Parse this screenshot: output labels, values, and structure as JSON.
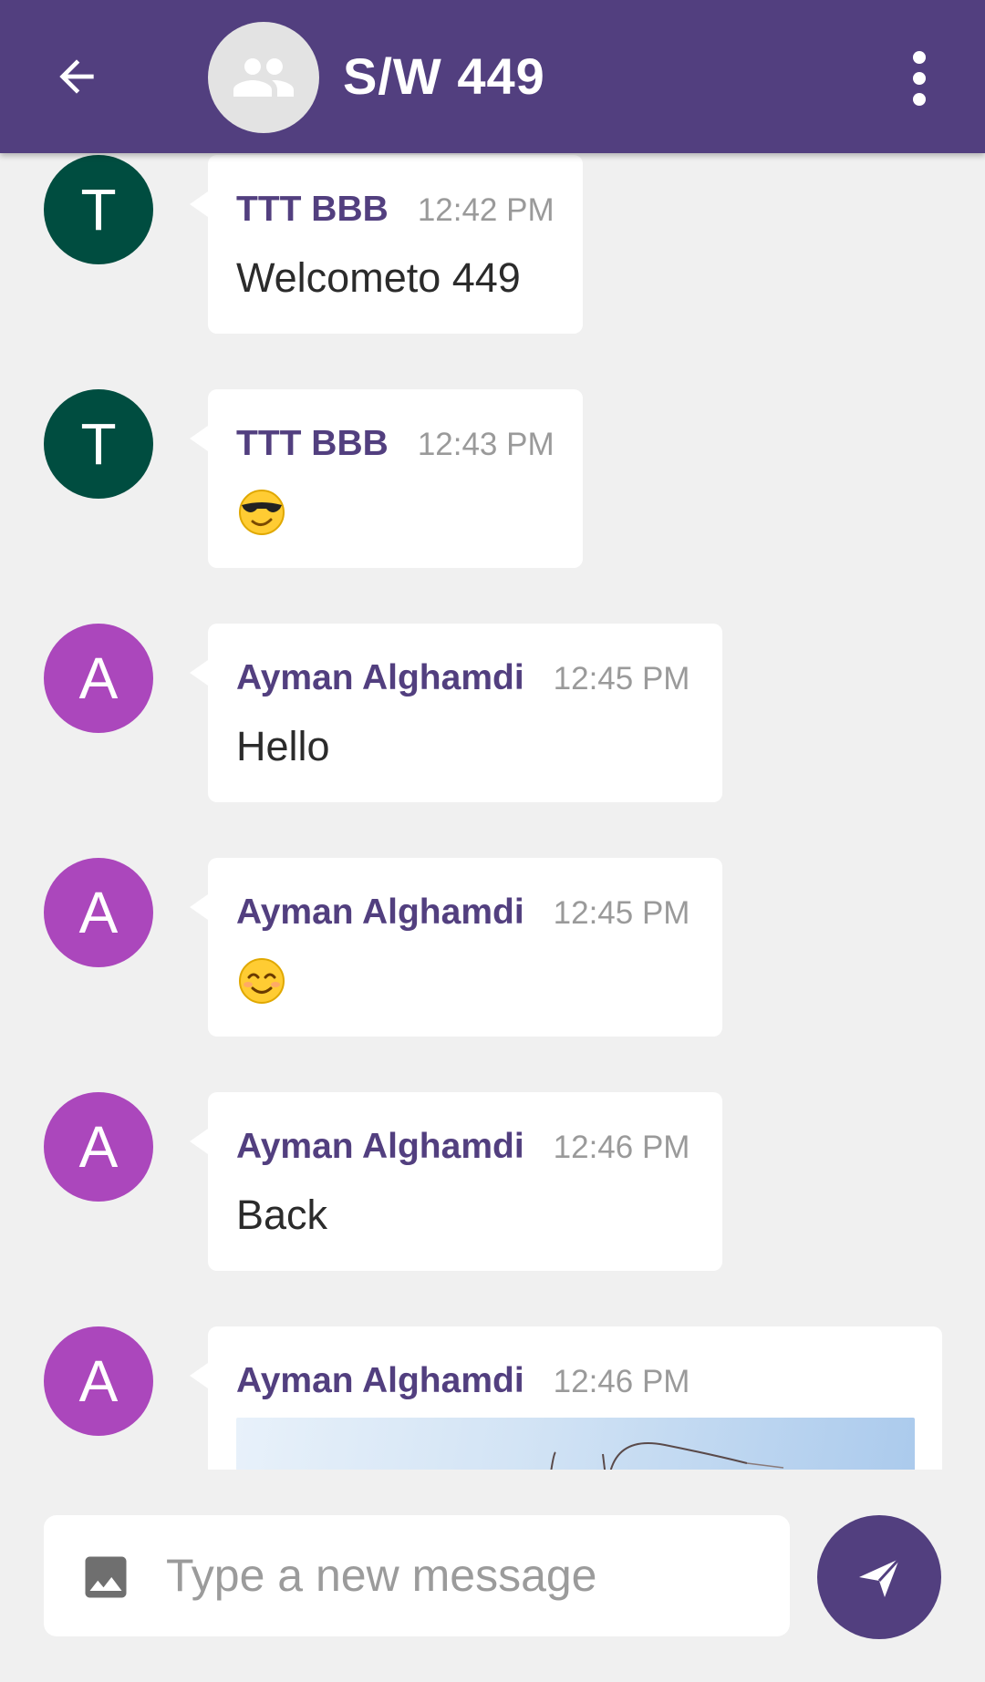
{
  "header": {
    "title": "S/W 449",
    "back_icon": "arrow-back-icon",
    "group_icon": "group-icon",
    "menu_icon": "more-vert-icon",
    "bar_color": "#523f7f"
  },
  "messages": [
    {
      "avatar_letter": "T",
      "avatar_color": "#004d40",
      "sender": "TTT BBB",
      "time": "12:42 PM",
      "text": "Welcometo 449"
    },
    {
      "avatar_letter": "T",
      "avatar_color": "#004d40",
      "sender": "TTT BBB",
      "time": "12:43 PM",
      "emoji": "smiling-face-with-sunglasses"
    },
    {
      "avatar_letter": "A",
      "avatar_color": "#ab47bc",
      "sender": "Ayman Alghamdi",
      "time": "12:45 PM",
      "text": "Hello"
    },
    {
      "avatar_letter": "A",
      "avatar_color": "#ab47bc",
      "sender": "Ayman Alghamdi",
      "time": "12:45 PM",
      "emoji": "smiling-face-with-smiling-eyes"
    },
    {
      "avatar_letter": "A",
      "avatar_color": "#ab47bc",
      "sender": "Ayman Alghamdi",
      "time": "12:46 PM",
      "text": "Back"
    },
    {
      "avatar_letter": "A",
      "avatar_color": "#ab47bc",
      "sender": "Ayman Alghamdi",
      "time": "12:46 PM",
      "attachment": "image"
    }
  ],
  "composer": {
    "placeholder": "Type a new message",
    "attach_icon": "image-icon",
    "send_icon": "send-icon"
  }
}
